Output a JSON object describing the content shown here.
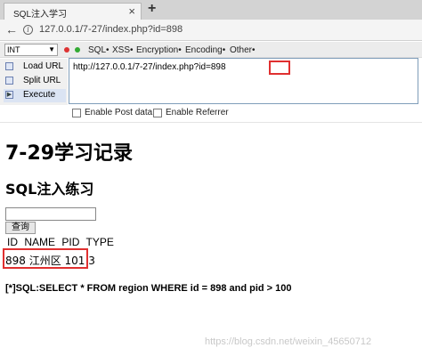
{
  "browser": {
    "tab_title": "SQL注入学习",
    "close_glyph": "×",
    "new_tab_glyph": "+",
    "back_glyph": "←",
    "info_glyph": "i",
    "url": "127.0.0.1/7-27/index.php?id=898"
  },
  "hackbar": {
    "encoding_select": "INT",
    "menus": [
      "SQL•",
      "XSS•",
      "Encryption•",
      "Encoding•",
      "Other•"
    ],
    "buttons": [
      {
        "label": "Load URL",
        "icon": "load-icon"
      },
      {
        "label": "Split URL",
        "icon": "split-icon"
      },
      {
        "label": "Execute",
        "icon": "execute-icon"
      }
    ],
    "url_text": "http://127.0.0.1/7-27/index.php?id=898",
    "post_label": "Enable Post data",
    "referrer_label": "Enable Referrer"
  },
  "page": {
    "heading": "7-29学习记录",
    "subheading": "SQL注入练习",
    "search_value": "",
    "query_button": "查询",
    "columns": [
      "ID",
      "NAME",
      "PID",
      "TYPE"
    ],
    "row": "898 江州区 101 3",
    "sql": "[*]SQL:SELECT * FROM region WHERE id = 898 and pid > 100"
  },
  "watermark": "https://blog.csdn.net/weixin_45650712",
  "colors": {
    "highlight": "#e03030",
    "tab_bar": "#d3d3d3",
    "textarea_border": "#7f9db9"
  }
}
